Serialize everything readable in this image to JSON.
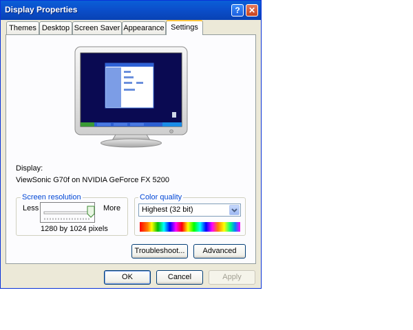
{
  "window": {
    "title": "Display Properties",
    "help_glyph": "?",
    "close_glyph": "✕"
  },
  "tabs": [
    {
      "label": "Themes",
      "active": false
    },
    {
      "label": "Desktop",
      "active": false
    },
    {
      "label": "Screen Saver",
      "active": false
    },
    {
      "label": "Appearance",
      "active": false
    },
    {
      "label": "Settings",
      "active": true
    }
  ],
  "display": {
    "label": "Display:",
    "device": "ViewSonic G70f on NVIDIA GeForce FX 5200"
  },
  "screen_resolution": {
    "legend": "Screen resolution",
    "less_label": "Less",
    "more_label": "More",
    "value_text": "1280 by 1024 pixels",
    "slider_position": 1.0
  },
  "color_quality": {
    "legend": "Color quality",
    "selected": "Highest (32 bit)"
  },
  "buttons": {
    "troubleshoot": "Troubleshoot...",
    "advanced": "Advanced",
    "ok": "OK",
    "cancel": "Cancel",
    "apply": "Apply"
  },
  "colors": {
    "titlebar": "#0b4fcb",
    "desktop_preview": "#0a0a52",
    "legend_text": "#0046d5"
  },
  "icons": {
    "help": "help-icon",
    "close": "close-icon",
    "dropdown": "chevron-down-icon",
    "monitor": "monitor-icon"
  }
}
